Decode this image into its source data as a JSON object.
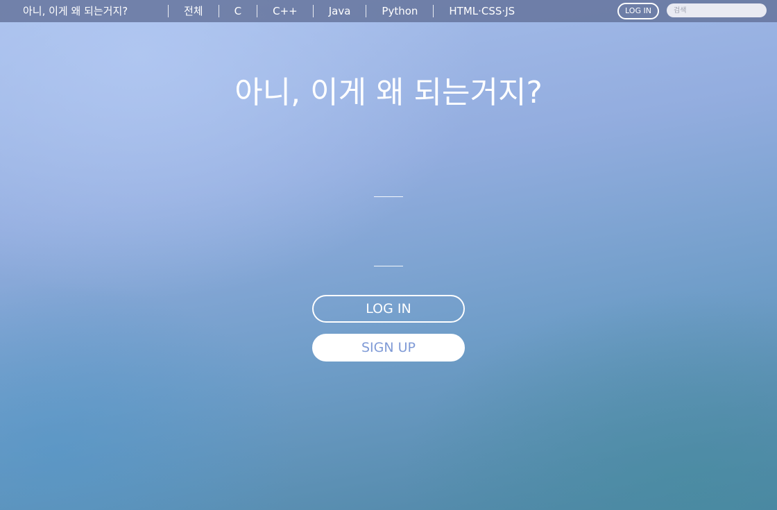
{
  "nav": {
    "brand": "아니, 이게 왜 되는거지?",
    "links": [
      "전체",
      "C",
      "C++",
      "Java",
      "Python",
      "HTML·CSS·JS"
    ],
    "login_label": "LOG IN",
    "search_placeholder": "검색",
    "search_value": ""
  },
  "hero": {
    "title": "아니, 이게 왜 되는거지?",
    "login_label": "LOG IN",
    "signup_label": "SIGN UP"
  },
  "colors": {
    "navbar": "#606e96",
    "signup_text": "#7f9ad6",
    "background_top": "#a9c0ec",
    "background_bottom": "#4c85a3"
  }
}
